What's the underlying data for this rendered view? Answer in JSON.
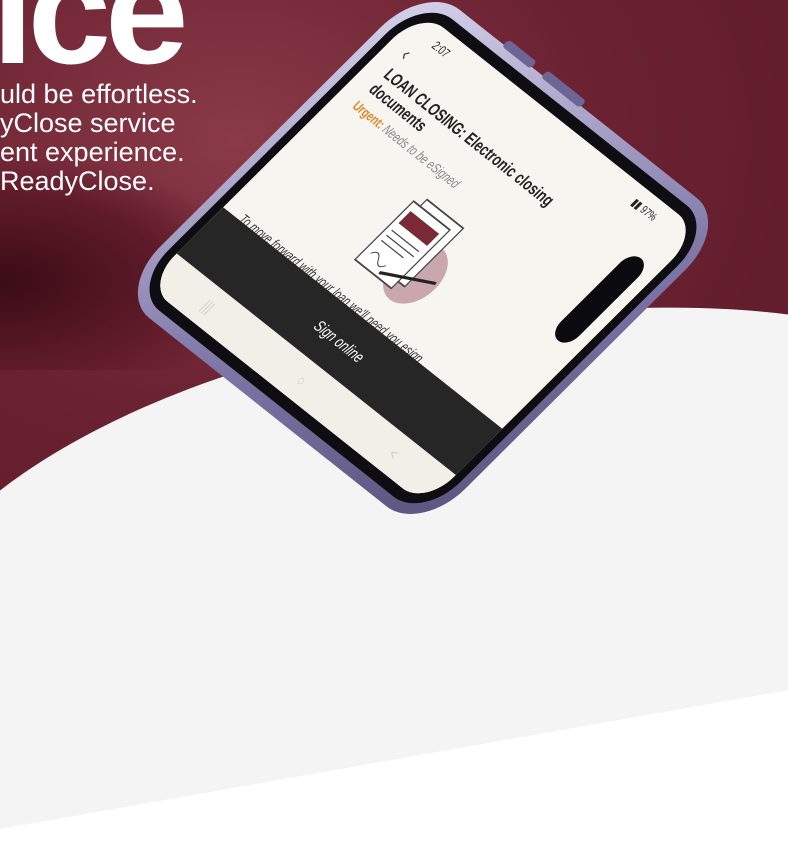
{
  "background": {
    "hero_word": "ice",
    "tagline_lines": [
      "uld be effortless.",
      "yClose  service",
      "ent experience.",
      "ReadyClose."
    ],
    "colors": {
      "maroon": "#6b2232",
      "white": "#ffffff"
    }
  },
  "phone": {
    "status_time": "2:07",
    "status_right": "97%",
    "back_icon": "chevron-left-icon",
    "email_subject": "LOAN CLOSING: Electronic closing documents",
    "urgent_label": "Urgent:",
    "urgent_text": "Needs to be eSigned",
    "illustration_icon": "signed-documents-pen-icon",
    "body_text": "To move forward with your loan we'll need you esign some documents via DocuSign.",
    "sign_button_label": "Sign online",
    "nav_icons": [
      "recent-apps-icon",
      "home-icon",
      "back-icon"
    ],
    "nav_glyphs": [
      "|||",
      "○",
      "<"
    ],
    "colors": {
      "urgent": "#e0862c",
      "button": "#262626",
      "frame": "#7f78a8"
    }
  }
}
